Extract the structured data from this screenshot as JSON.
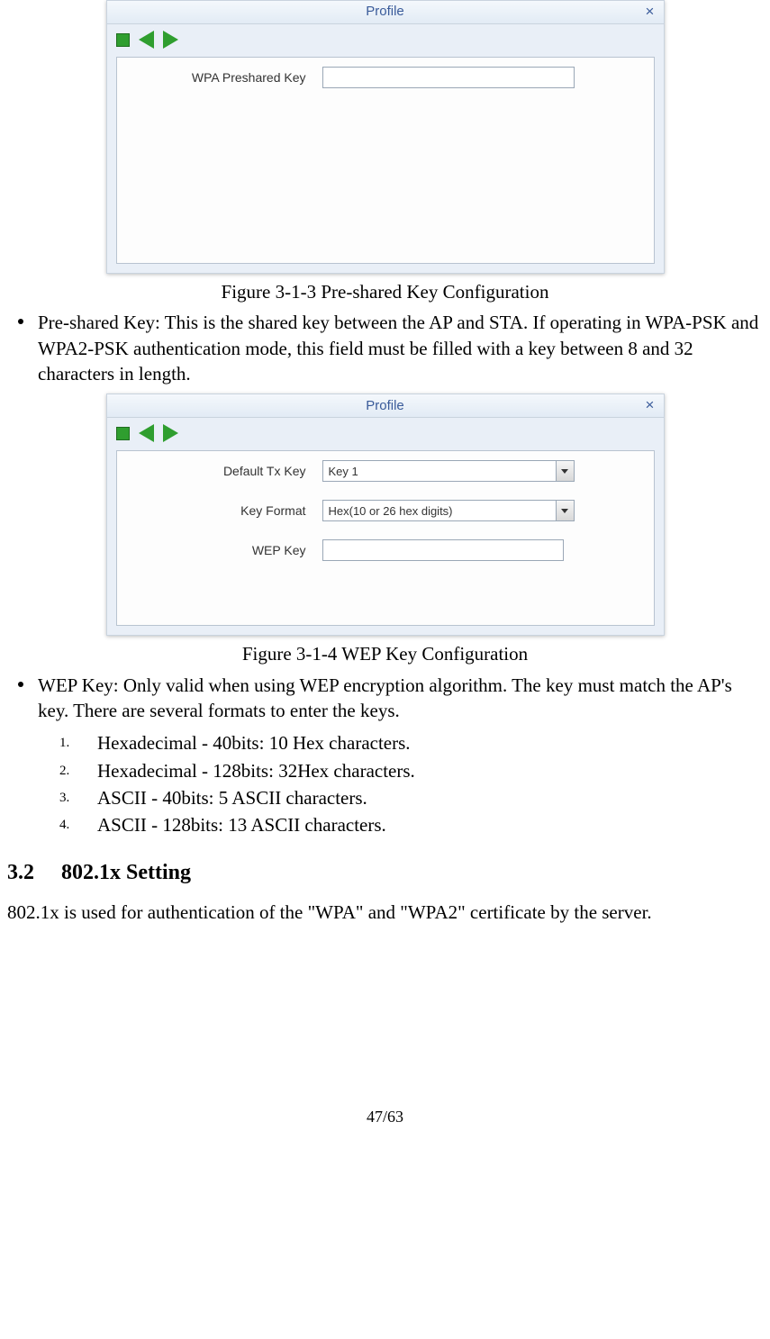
{
  "dialog1": {
    "title": "Profile",
    "field_label": "WPA Preshared Key",
    "field_value": ""
  },
  "caption1": "Figure 3-1-3 Pre-shared Key Configuration",
  "bullet1": "Pre-shared Key: This is the shared key between the AP and STA. If operating in WPA-PSK and WPA2-PSK authentication mode, this field must be filled with a key between 8 and 32 characters in length.",
  "dialog2": {
    "title": "Profile",
    "fields": {
      "default_tx_key_label": "Default Tx Key",
      "default_tx_key_value": "Key 1",
      "key_format_label": "Key Format",
      "key_format_value": "Hex(10 or 26 hex digits)",
      "wep_key_label": "WEP Key",
      "wep_key_value": ""
    }
  },
  "caption2": "Figure 3-1-4 WEP Key Configuration",
  "bullet2": "WEP Key: Only valid when using WEP encryption algorithm. The key must match the AP's key. There are several formats to enter the keys.",
  "numlist": [
    "Hexadecimal - 40bits: 10 Hex characters.",
    "Hexadecimal - 128bits: 32Hex characters.",
    "ASCII - 40bits: 5 ASCII characters.",
    "ASCII - 128bits: 13 ASCII characters."
  ],
  "section": {
    "num": "3.2",
    "title": "802.1x Setting"
  },
  "section_body": "802.1x is used for authentication of the \"WPA\" and \"WPA2\" certificate by the server.",
  "page_footer": "47/63"
}
